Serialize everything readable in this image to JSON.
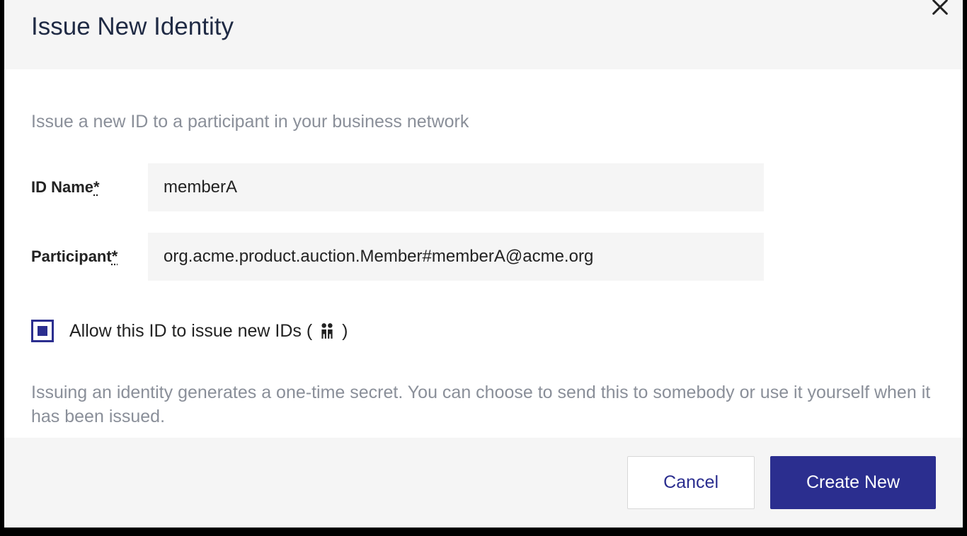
{
  "modal": {
    "title": "Issue New Identity",
    "subhead": "Issue a new ID to a participant in your business network",
    "fields": {
      "id_name": {
        "label": "ID Name",
        "required_mark": "*",
        "value": "memberA"
      },
      "participant": {
        "label": "Participant",
        "required_mark": "*",
        "value": "org.acme.product.auction.Member#memberA@acme.org"
      }
    },
    "checkbox": {
      "label_pre": "Allow this ID to issue new IDs ( ",
      "label_post": " )",
      "checked": true
    },
    "info": "Issuing an identity generates a one-time secret. You can choose to send this to somebody or use it yourself when it has been issued.",
    "buttons": {
      "cancel": "Cancel",
      "create": "Create New"
    }
  }
}
